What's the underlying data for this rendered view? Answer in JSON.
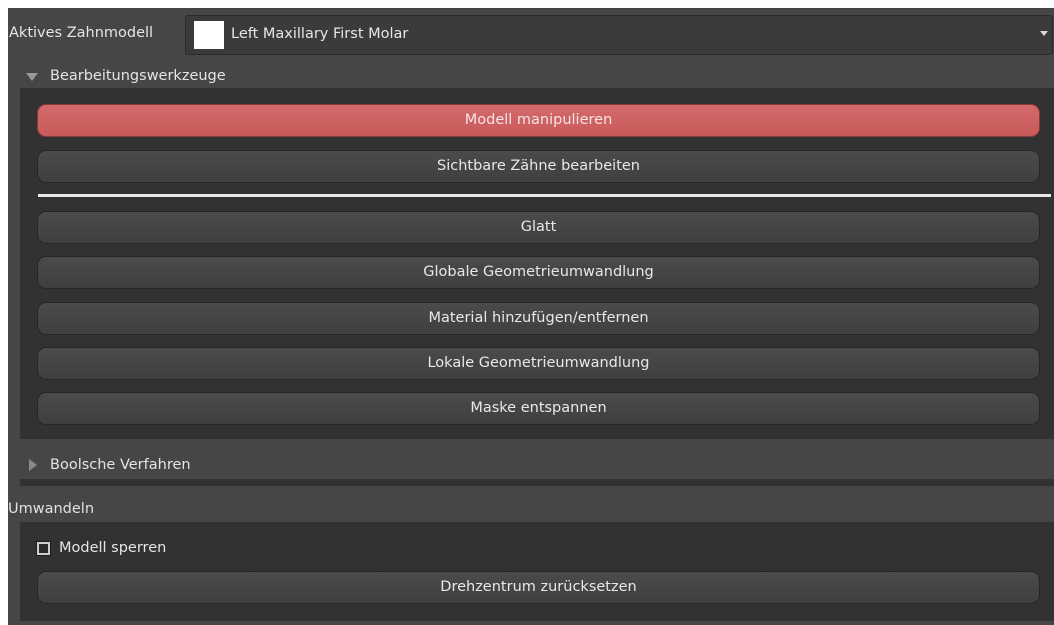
{
  "model": {
    "label": "Aktives Zahnmodell",
    "selected": "Left Maxillary First Molar",
    "swatch_color": "#ffffff"
  },
  "tools_section": {
    "title": "Bearbeitungswerkzeuge",
    "expanded": true,
    "primary_buttons": [
      {
        "label": "Modell manipulieren",
        "active": true
      },
      {
        "label": "Sichtbare Zähne bearbeiten",
        "active": false
      }
    ],
    "tool_buttons": [
      {
        "label": "Glatt"
      },
      {
        "label": "Globale Geometrieumwandlung"
      },
      {
        "label": "Material hinzufügen/entfernen"
      },
      {
        "label": "Lokale Geometrieumwandlung"
      },
      {
        "label": "Maske entspannen"
      }
    ]
  },
  "boolean_section": {
    "title": "Boolsche Verfahren",
    "expanded": false
  },
  "transform_section": {
    "title": "Umwandeln",
    "lock_model": {
      "label": "Modell sperren",
      "checked": true
    },
    "reset_button": "Drehzentrum zurücksetzen"
  },
  "colors": {
    "active_button": "#d0625f",
    "panel_bg": "#323232",
    "window_bg": "#464646"
  }
}
